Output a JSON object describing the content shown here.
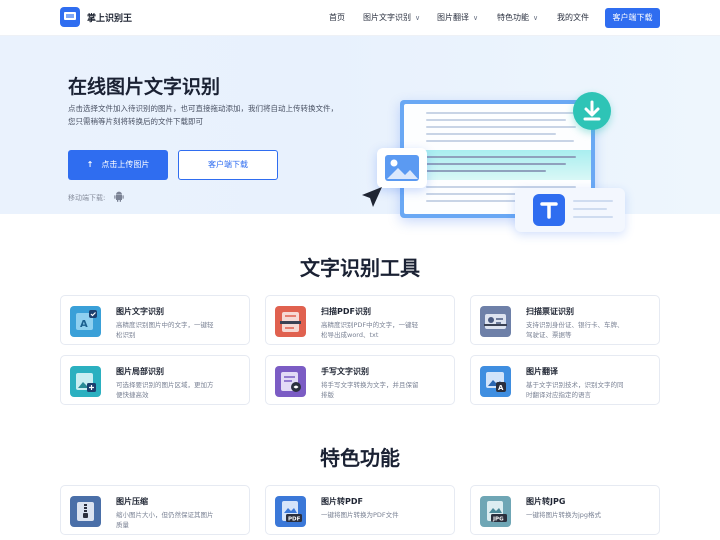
{
  "header": {
    "brand": "掌上识别王",
    "nav": [
      {
        "label": "首页",
        "caret": false
      },
      {
        "label": "图片文字识别",
        "caret": true
      },
      {
        "label": "图片翻译",
        "caret": true
      },
      {
        "label": "特色功能",
        "caret": true
      },
      {
        "label": "我的文件",
        "caret": false
      }
    ],
    "download_button": "客户端下载"
  },
  "hero": {
    "title": "在线图片文字识别",
    "desc_lines": [
      "点击选择文件加入待识别的图片，也可直接拖动添加，我们将自动上传转换文件，",
      "您只需稍等片刻将转换后的文件下载即可"
    ],
    "upload_button": "点击上传图片",
    "client_button": "客户端下载",
    "mobile_label": "移动端下载:"
  },
  "tools": {
    "title": "文字识别工具",
    "cards": [
      {
        "name": "图片文字识别",
        "desc": [
          "高精度识别图片中的文字，一键轻",
          "松识别"
        ],
        "icon": "image-text-ocr-icon",
        "color": "#3aa0d8"
      },
      {
        "name": "扫描PDF识别",
        "desc": [
          "高精度识别PDF中的文字，一键轻",
          "松导出成word、txt"
        ],
        "icon": "scan-pdf-icon",
        "color": "#e0614f"
      },
      {
        "name": "扫描票证识别",
        "desc": [
          "支持识别身份证、银行卡、车牌、",
          "驾驶证、票据等"
        ],
        "icon": "scan-id-card-icon",
        "color": "#6e80a8"
      },
      {
        "name": "图片局部识别",
        "desc": [
          "可选择要识别的图片区域，更加方",
          "便快捷高效"
        ],
        "icon": "image-crop-icon",
        "color": "#2bb0c0"
      },
      {
        "name": "手写文字识别",
        "desc": [
          "将手写文字转换为文字，并且保留",
          "排版"
        ],
        "icon": "handwriting-icon",
        "color": "#7b5cc4"
      },
      {
        "name": "图片翻译",
        "desc": [
          "基于文字识别技术，识别文字的同",
          "时翻译对应指定的语言"
        ],
        "icon": "image-translate-icon",
        "color": "#3f8ee0"
      }
    ]
  },
  "features": {
    "title": "特色功能",
    "cards": [
      {
        "name": "图片压缩",
        "desc": [
          "缩小图片大小，但仍然保证其图片",
          "质量"
        ],
        "icon": "image-compress-icon",
        "color": "#4a6fa8",
        "badge": ""
      },
      {
        "name": "图片转PDF",
        "desc": [
          "一键将图片转换为PDF文件"
        ],
        "icon": "image-to-pdf-icon",
        "color": "#3b78d8",
        "badge": "PDF"
      },
      {
        "name": "图片转JPG",
        "desc": [
          "一键将图片转换为jpg格式"
        ],
        "icon": "image-to-jpg-icon",
        "color": "#6fa6b5",
        "badge": "JPG"
      }
    ]
  },
  "colors": {
    "accent": "#2f6df0",
    "teal": "#2ec4b6",
    "hero_bg": "#eaf2fd"
  }
}
